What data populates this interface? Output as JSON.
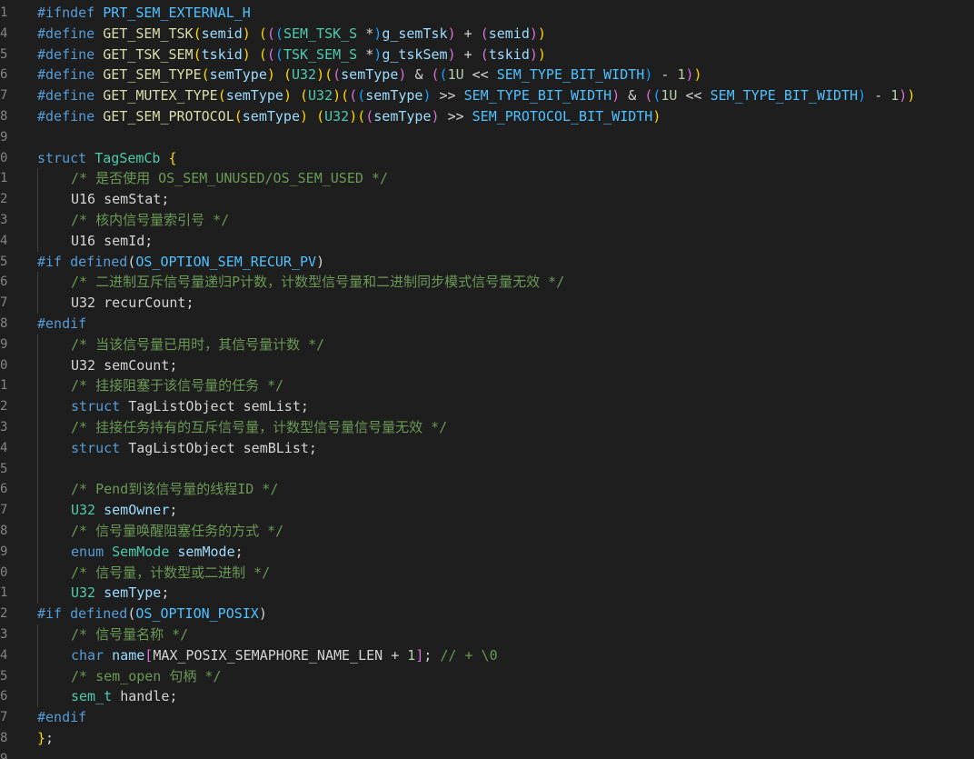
{
  "colors": {
    "background": "#1e1e1e",
    "line_number": "#858585",
    "keyword": "#569cd6",
    "macro": "#4fc1ff",
    "function": "#dcdcaa",
    "type": "#4ec9b0",
    "comment": "#6a9955",
    "number": "#b5cea8",
    "variable": "#9cdcfe",
    "bracket_gold": "#ffd700",
    "bracket_purple": "#da70d6",
    "bracket_blue": "#179fff",
    "plain": "#d4d4d4"
  },
  "lines": [
    {
      "n": "1",
      "indent": 0,
      "tokens": [
        {
          "t": "#ifndef ",
          "c": "keyword"
        },
        {
          "t": "PRT_SEM_EXTERNAL_H",
          "c": "macro"
        }
      ]
    },
    {
      "n": "4",
      "indent": 0,
      "tokens": [
        {
          "t": "#define ",
          "c": "keyword"
        },
        {
          "t": "GET_SEM_TSK",
          "c": "function"
        },
        {
          "t": "(",
          "c": "bracket_gold"
        },
        {
          "t": "semid",
          "c": "variable"
        },
        {
          "t": ") ",
          "c": "bracket_gold"
        },
        {
          "t": "(",
          "c": "bracket_gold"
        },
        {
          "t": "(",
          "c": "bracket_purple"
        },
        {
          "t": "(",
          "c": "bracket_blue"
        },
        {
          "t": "SEM_TSK_S ",
          "c": "type"
        },
        {
          "t": "*",
          "c": "plain"
        },
        {
          "t": ")",
          "c": "bracket_blue"
        },
        {
          "t": "g_semTsk",
          "c": "variable"
        },
        {
          "t": ") ",
          "c": "bracket_purple"
        },
        {
          "t": "+ ",
          "c": "plain"
        },
        {
          "t": "(",
          "c": "bracket_purple"
        },
        {
          "t": "semid",
          "c": "variable"
        },
        {
          "t": ")",
          "c": "bracket_purple"
        },
        {
          "t": ")",
          "c": "bracket_gold"
        }
      ]
    },
    {
      "n": "5",
      "indent": 0,
      "tokens": [
        {
          "t": "#define ",
          "c": "keyword"
        },
        {
          "t": "GET_TSK_SEM",
          "c": "function"
        },
        {
          "t": "(",
          "c": "bracket_gold"
        },
        {
          "t": "tskid",
          "c": "variable"
        },
        {
          "t": ") ",
          "c": "bracket_gold"
        },
        {
          "t": "(",
          "c": "bracket_gold"
        },
        {
          "t": "(",
          "c": "bracket_purple"
        },
        {
          "t": "(",
          "c": "bracket_blue"
        },
        {
          "t": "TSK_SEM_S ",
          "c": "type"
        },
        {
          "t": "*",
          "c": "plain"
        },
        {
          "t": ")",
          "c": "bracket_blue"
        },
        {
          "t": "g_tskSem",
          "c": "variable"
        },
        {
          "t": ") ",
          "c": "bracket_purple"
        },
        {
          "t": "+ ",
          "c": "plain"
        },
        {
          "t": "(",
          "c": "bracket_purple"
        },
        {
          "t": "tskid",
          "c": "variable"
        },
        {
          "t": ")",
          "c": "bracket_purple"
        },
        {
          "t": ")",
          "c": "bracket_gold"
        }
      ]
    },
    {
      "n": "6",
      "indent": 0,
      "tokens": [
        {
          "t": "#define ",
          "c": "keyword"
        },
        {
          "t": "GET_SEM_TYPE",
          "c": "function"
        },
        {
          "t": "(",
          "c": "bracket_gold"
        },
        {
          "t": "semType",
          "c": "variable"
        },
        {
          "t": ") ",
          "c": "bracket_gold"
        },
        {
          "t": "(",
          "c": "bracket_gold"
        },
        {
          "t": "U32",
          "c": "type"
        },
        {
          "t": ")",
          "c": "bracket_gold"
        },
        {
          "t": "(",
          "c": "bracket_gold"
        },
        {
          "t": "(",
          "c": "bracket_purple"
        },
        {
          "t": "semType",
          "c": "variable"
        },
        {
          "t": ") ",
          "c": "bracket_purple"
        },
        {
          "t": "& ",
          "c": "plain"
        },
        {
          "t": "(",
          "c": "bracket_purple"
        },
        {
          "t": "(",
          "c": "bracket_blue"
        },
        {
          "t": "1U ",
          "c": "number"
        },
        {
          "t": "<< ",
          "c": "plain"
        },
        {
          "t": "SEM_TYPE_BIT_WIDTH",
          "c": "macro"
        },
        {
          "t": ") ",
          "c": "bracket_blue"
        },
        {
          "t": "- ",
          "c": "plain"
        },
        {
          "t": "1",
          "c": "number"
        },
        {
          "t": ")",
          "c": "bracket_purple"
        },
        {
          "t": ")",
          "c": "bracket_gold"
        }
      ]
    },
    {
      "n": "7",
      "indent": 0,
      "tokens": [
        {
          "t": "#define ",
          "c": "keyword"
        },
        {
          "t": "GET_MUTEX_TYPE",
          "c": "function"
        },
        {
          "t": "(",
          "c": "bracket_gold"
        },
        {
          "t": "semType",
          "c": "variable"
        },
        {
          "t": ") ",
          "c": "bracket_gold"
        },
        {
          "t": "(",
          "c": "bracket_gold"
        },
        {
          "t": "U32",
          "c": "type"
        },
        {
          "t": ")",
          "c": "bracket_gold"
        },
        {
          "t": "(",
          "c": "bracket_gold"
        },
        {
          "t": "(",
          "c": "bracket_purple"
        },
        {
          "t": "(",
          "c": "bracket_blue"
        },
        {
          "t": "semType",
          "c": "variable"
        },
        {
          "t": ") ",
          "c": "bracket_blue"
        },
        {
          "t": ">> ",
          "c": "plain"
        },
        {
          "t": "SEM_TYPE_BIT_WIDTH",
          "c": "macro"
        },
        {
          "t": ") ",
          "c": "bracket_purple"
        },
        {
          "t": "& ",
          "c": "plain"
        },
        {
          "t": "(",
          "c": "bracket_purple"
        },
        {
          "t": "(",
          "c": "bracket_blue"
        },
        {
          "t": "1U ",
          "c": "number"
        },
        {
          "t": "<< ",
          "c": "plain"
        },
        {
          "t": "SEM_TYPE_BIT_WIDTH",
          "c": "macro"
        },
        {
          "t": ") ",
          "c": "bracket_blue"
        },
        {
          "t": "- ",
          "c": "plain"
        },
        {
          "t": "1",
          "c": "number"
        },
        {
          "t": ")",
          "c": "bracket_purple"
        },
        {
          "t": ")",
          "c": "bracket_gold"
        }
      ]
    },
    {
      "n": "8",
      "indent": 0,
      "tokens": [
        {
          "t": "#define ",
          "c": "keyword"
        },
        {
          "t": "GET_SEM_PROTOCOL",
          "c": "function"
        },
        {
          "t": "(",
          "c": "bracket_gold"
        },
        {
          "t": "semType",
          "c": "variable"
        },
        {
          "t": ") ",
          "c": "bracket_gold"
        },
        {
          "t": "(",
          "c": "bracket_gold"
        },
        {
          "t": "U32",
          "c": "type"
        },
        {
          "t": ")",
          "c": "bracket_gold"
        },
        {
          "t": "(",
          "c": "bracket_gold"
        },
        {
          "t": "(",
          "c": "bracket_purple"
        },
        {
          "t": "semType",
          "c": "variable"
        },
        {
          "t": ") ",
          "c": "bracket_purple"
        },
        {
          "t": ">> ",
          "c": "plain"
        },
        {
          "t": "SEM_PROTOCOL_BIT_WIDTH",
          "c": "macro"
        },
        {
          "t": ")",
          "c": "bracket_gold"
        }
      ]
    },
    {
      "n": "9",
      "indent": 0,
      "tokens": []
    },
    {
      "n": "0",
      "indent": 0,
      "tokens": [
        {
          "t": "struct ",
          "c": "keyword"
        },
        {
          "t": "TagSemCb ",
          "c": "type"
        },
        {
          "t": "{",
          "c": "bracket_gold"
        }
      ]
    },
    {
      "n": "1",
      "indent": 1,
      "tokens": [
        {
          "t": "/* 是否使用 OS_SEM_UNUSED/OS_SEM_USED */",
          "c": "comment"
        }
      ]
    },
    {
      "n": "2",
      "indent": 1,
      "tokens": [
        {
          "t": "U16 ",
          "c": "plain"
        },
        {
          "t": "semStat",
          "c": "plain"
        },
        {
          "t": ";",
          "c": "plain"
        }
      ]
    },
    {
      "n": "3",
      "indent": 1,
      "tokens": [
        {
          "t": "/* 核内信号量索引号 */",
          "c": "comment"
        }
      ]
    },
    {
      "n": "4",
      "indent": 1,
      "tokens": [
        {
          "t": "U16 ",
          "c": "plain"
        },
        {
          "t": "semId",
          "c": "plain"
        },
        {
          "t": ";",
          "c": "plain"
        }
      ]
    },
    {
      "n": "5",
      "indent": 0,
      "tokens": [
        {
          "t": "#if ",
          "c": "keyword"
        },
        {
          "t": "defined",
          "c": "keyword"
        },
        {
          "t": "(",
          "c": "plain"
        },
        {
          "t": "OS_OPTION_SEM_RECUR_PV",
          "c": "macro"
        },
        {
          "t": ")",
          "c": "plain"
        }
      ]
    },
    {
      "n": "6",
      "indent": 1,
      "tokens": [
        {
          "t": "/* 二进制互斥信号量递归P计数，计数型信号量和二进制同步模式信号量无效 */",
          "c": "comment"
        }
      ]
    },
    {
      "n": "7",
      "indent": 1,
      "tokens": [
        {
          "t": "U32 ",
          "c": "plain"
        },
        {
          "t": "recurCount",
          "c": "plain"
        },
        {
          "t": ";",
          "c": "plain"
        }
      ]
    },
    {
      "n": "8",
      "indent": 0,
      "tokens": [
        {
          "t": "#endif",
          "c": "keyword"
        }
      ]
    },
    {
      "n": "9",
      "indent": 1,
      "tokens": [
        {
          "t": "/* 当该信号量已用时，其信号量计数 */",
          "c": "comment"
        }
      ]
    },
    {
      "n": "0",
      "indent": 1,
      "tokens": [
        {
          "t": "U32 ",
          "c": "plain"
        },
        {
          "t": "semCount",
          "c": "plain"
        },
        {
          "t": ";",
          "c": "plain"
        }
      ]
    },
    {
      "n": "1",
      "indent": 1,
      "tokens": [
        {
          "t": "/* 挂接阻塞于该信号量的任务 */",
          "c": "comment"
        }
      ]
    },
    {
      "n": "2",
      "indent": 1,
      "tokens": [
        {
          "t": "struct ",
          "c": "keyword"
        },
        {
          "t": "TagListObject ",
          "c": "plain"
        },
        {
          "t": "semList",
          "c": "plain"
        },
        {
          "t": ";",
          "c": "plain"
        }
      ]
    },
    {
      "n": "3",
      "indent": 1,
      "tokens": [
        {
          "t": "/* 挂接任务持有的互斥信号量，计数型信号量信号量无效 */",
          "c": "comment"
        }
      ]
    },
    {
      "n": "4",
      "indent": 1,
      "tokens": [
        {
          "t": "struct ",
          "c": "keyword"
        },
        {
          "t": "TagListObject ",
          "c": "plain"
        },
        {
          "t": "semBList",
          "c": "plain"
        },
        {
          "t": ";",
          "c": "plain"
        }
      ]
    },
    {
      "n": "5",
      "indent": 1,
      "tokens": []
    },
    {
      "n": "6",
      "indent": 1,
      "tokens": [
        {
          "t": "/* Pend到该信号量的线程ID */",
          "c": "comment"
        }
      ]
    },
    {
      "n": "7",
      "indent": 1,
      "tokens": [
        {
          "t": "U32 ",
          "c": "type"
        },
        {
          "t": "semOwner",
          "c": "variable"
        },
        {
          "t": ";",
          "c": "plain"
        }
      ]
    },
    {
      "n": "8",
      "indent": 1,
      "tokens": [
        {
          "t": "/* 信号量唤醒阻塞任务的方式 */",
          "c": "comment"
        }
      ]
    },
    {
      "n": "9",
      "indent": 1,
      "tokens": [
        {
          "t": "enum ",
          "c": "keyword"
        },
        {
          "t": "SemMode ",
          "c": "type"
        },
        {
          "t": "semMode",
          "c": "variable"
        },
        {
          "t": ";",
          "c": "plain"
        }
      ]
    },
    {
      "n": "0",
      "indent": 1,
      "tokens": [
        {
          "t": "/* 信号量，计数型或二进制 */",
          "c": "comment"
        }
      ]
    },
    {
      "n": "1",
      "indent": 1,
      "tokens": [
        {
          "t": "U32 ",
          "c": "type"
        },
        {
          "t": "semType",
          "c": "variable"
        },
        {
          "t": ";",
          "c": "plain"
        }
      ]
    },
    {
      "n": "2",
      "indent": 0,
      "tokens": [
        {
          "t": "#if ",
          "c": "keyword"
        },
        {
          "t": "defined",
          "c": "keyword"
        },
        {
          "t": "(",
          "c": "plain"
        },
        {
          "t": "OS_OPTION_POSIX",
          "c": "macro"
        },
        {
          "t": ")",
          "c": "plain"
        }
      ]
    },
    {
      "n": "3",
      "indent": 1,
      "tokens": [
        {
          "t": "/* 信号量名称 */",
          "c": "comment"
        }
      ]
    },
    {
      "n": "4",
      "indent": 1,
      "tokens": [
        {
          "t": "char ",
          "c": "keyword"
        },
        {
          "t": "name",
          "c": "variable"
        },
        {
          "t": "[",
          "c": "bracket_purple"
        },
        {
          "t": "MAX_POSIX_SEMAPHORE_NAME_LEN ",
          "c": "plain"
        },
        {
          "t": "+ ",
          "c": "plain"
        },
        {
          "t": "1",
          "c": "number"
        },
        {
          "t": "]",
          "c": "bracket_purple"
        },
        {
          "t": "; ",
          "c": "plain"
        },
        {
          "t": "// + \\0",
          "c": "comment"
        }
      ]
    },
    {
      "n": "5",
      "indent": 1,
      "tokens": [
        {
          "t": "/* sem_open 句柄 */",
          "c": "comment"
        }
      ]
    },
    {
      "n": "6",
      "indent": 1,
      "tokens": [
        {
          "t": "sem_t ",
          "c": "type"
        },
        {
          "t": "handle",
          "c": "plain"
        },
        {
          "t": ";",
          "c": "plain"
        }
      ]
    },
    {
      "n": "7",
      "indent": 0,
      "tokens": [
        {
          "t": "#endif",
          "c": "keyword"
        }
      ]
    },
    {
      "n": "8",
      "indent": 0,
      "tokens": [
        {
          "t": "}",
          "c": "bracket_gold"
        },
        {
          "t": ";",
          "c": "plain"
        }
      ]
    },
    {
      "n": "9",
      "indent": 0,
      "tokens": []
    }
  ]
}
